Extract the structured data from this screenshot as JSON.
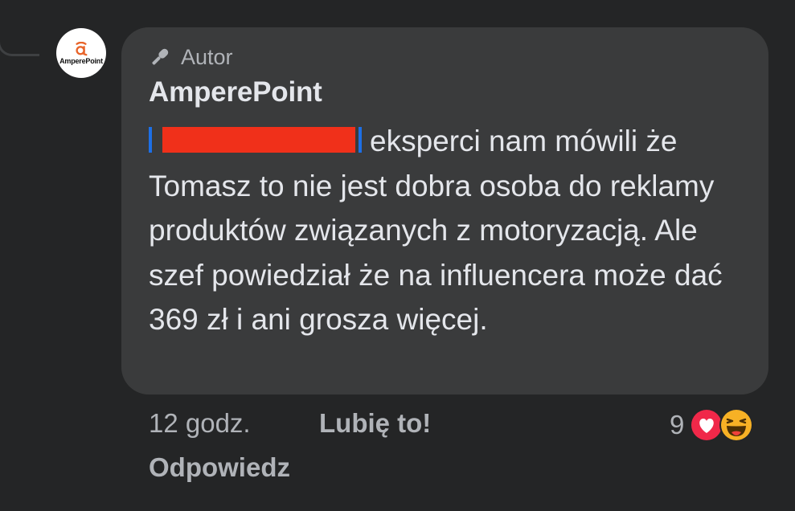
{
  "avatar": {
    "brand_text": "AmperePoint",
    "brand_color": "#e8642a"
  },
  "comment": {
    "badge_label": "Autor",
    "author": "AmperePoint",
    "text": "eksperci nam mówili że Tomasz to nie jest dobra osoba do reklamy produktów związanych z motoryzacją. Ale szef powiedział że na influencera może dać 369 zł i ani grosza więcej."
  },
  "actions": {
    "timestamp": "12 godz.",
    "like_label": "Lubię to!",
    "reply_label": "Odpowiedz"
  },
  "reactions": {
    "count": "9",
    "types": [
      "love-icon",
      "haha-icon"
    ]
  },
  "colors": {
    "background": "#242526",
    "bubble": "#3a3b3c",
    "text": "#e4e6eb",
    "secondary_text": "#b0b3b8",
    "mention_blue": "#1d6fe6",
    "redaction": "#f0301a"
  }
}
